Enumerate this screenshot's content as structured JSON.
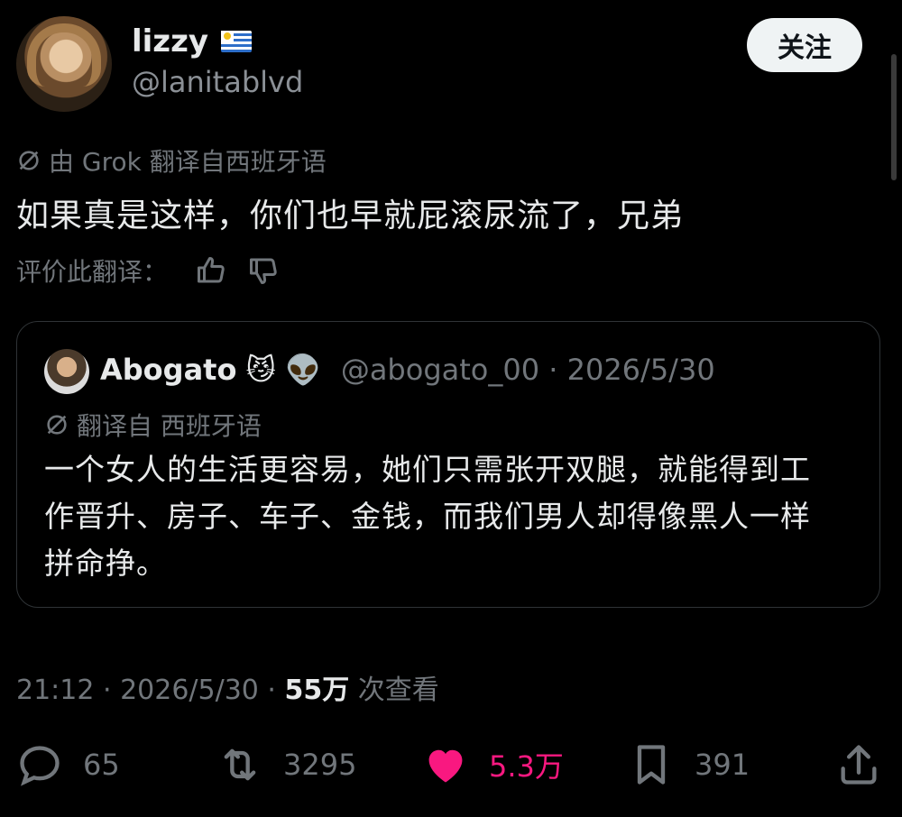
{
  "author": {
    "display_name": "lizzy",
    "flag_icon": "uruguay-flag-icon",
    "handle": "@lanitablvd",
    "follow_label": "关注"
  },
  "translation": {
    "note": "由 Grok 翻译自西班牙语",
    "text": "如果真是这样，你们也早就屁滚尿流了，兄弟",
    "rate_label": "评价此翻译："
  },
  "quote": {
    "name": "Abogato",
    "emojis": "😼 👽",
    "meta": "@abogato_00 · 2026/5/30",
    "translate_note": "翻译自 西班牙语",
    "text": "一个女人的生活更容易，她们只需张开双腿，就能得到工作晋升、房子、车子、金钱，而我们男人却得像黑人一样拼命挣。"
  },
  "timestamp": {
    "time": "21:12 · 2026/5/30 · ",
    "views_count": "55万",
    "views_label": " 次查看"
  },
  "actions": {
    "replies": "65",
    "reposts": "3295",
    "likes": "5.3万",
    "bookmarks": "391"
  },
  "colors": {
    "background": "#000000",
    "text": "#e7e9ea",
    "muted": "#71767b",
    "like": "#f91880",
    "border": "#2f3336"
  }
}
